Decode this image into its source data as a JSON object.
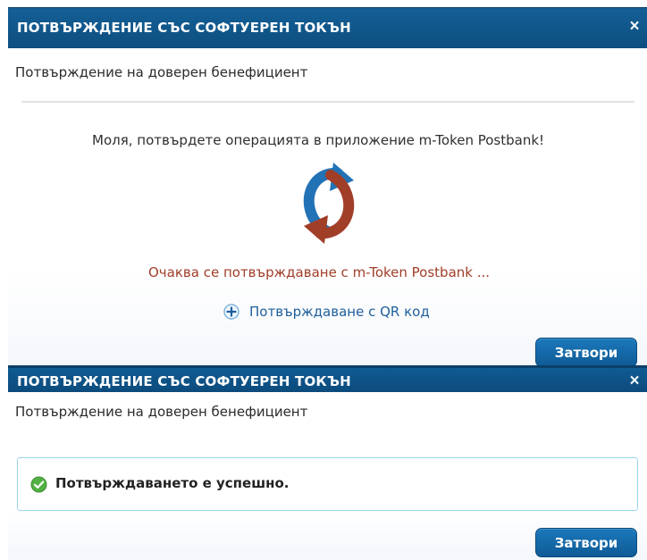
{
  "dialogs": [
    {
      "title": "ПОТВЪРЖДЕНИЕ СЪС СОФТУЕРЕН ТОКЪН",
      "close_symbol": "×",
      "subtitle": "Потвърждение на доверен бенефициент",
      "prompt": "Моля, потвърдете операцията в приложение m-Token Postbank!",
      "waiting": "Очаква се потвърждаване с m-Token Postbank ...",
      "qr_link": "Потвърждаване с QR код",
      "close_button": "Затвори",
      "icon": "sync-icon"
    },
    {
      "title": "ПОТВЪРЖДЕНИЕ СЪС СОФТУЕРЕН ТОКЪН",
      "close_symbol": "×",
      "subtitle": "Потвърждение на доверен бенефициент",
      "success": "Потвърждаването е успешно.",
      "close_button": "Затвори",
      "icon": "success-check-icon"
    }
  ],
  "colors": {
    "header_blue": "#0f5b92",
    "button_blue": "#156aa9",
    "waiting_red": "#a13e28",
    "link_blue": "#1f5f9b",
    "success_green": "#52b044",
    "success_border": "#9ad6ec"
  }
}
